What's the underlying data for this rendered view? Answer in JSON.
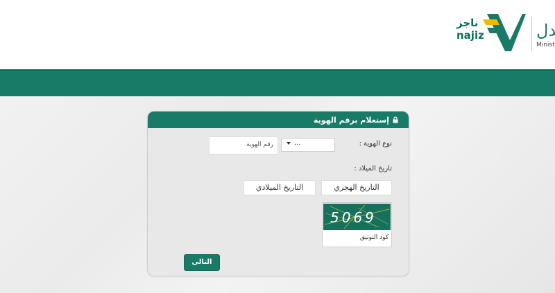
{
  "header": {
    "najiz_logo_text": "najiz",
    "najiz_logo_ar": "ناجز",
    "ministry_ar": "ـدل",
    "ministry_en": "Minist"
  },
  "form": {
    "title": "إستعلام برقم الهوية",
    "id_type_label": "نوع الهوية :",
    "id_type_value": "...",
    "id_number_placeholder": "رقم الهوية",
    "birth_date_label": "تاريخ الميلاد :",
    "hijri_option": "التاريخ الهجري",
    "gregorian_option": "التاريخ الميلادي",
    "captcha_text": "5069",
    "captcha_label": "كود التوثيق",
    "next_button": "التالى"
  },
  "colors": {
    "brand_green": "#177b68",
    "najiz_yellow": "#f2b705"
  }
}
